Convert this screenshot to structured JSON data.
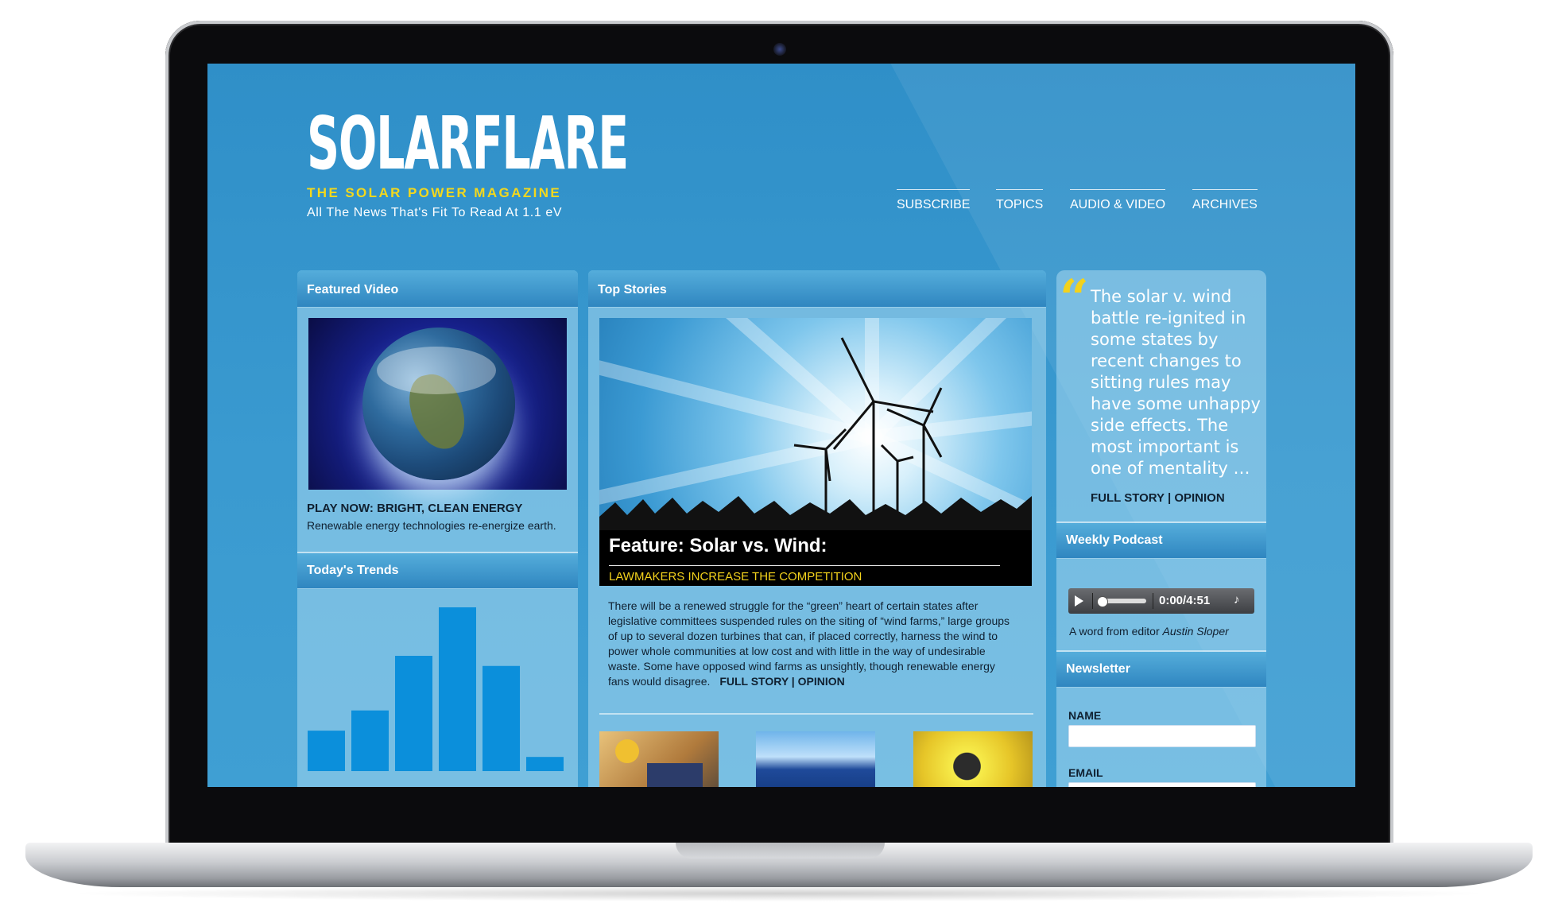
{
  "site": {
    "logo": "SOLARFLARE",
    "tagline": "THE SOLAR POWER MAGAZINE",
    "subtitle": "All The News That's Fit To Read At 1.1 eV"
  },
  "nav": {
    "items": [
      {
        "label": "SUBSCRIBE"
      },
      {
        "label": "TOPICS"
      },
      {
        "label": "AUDIO & VIDEO"
      },
      {
        "label": "ARCHIVES"
      }
    ]
  },
  "featured_video": {
    "heading": "Featured Video",
    "title": "PLAY NOW: BRIGHT, CLEAN ENERGY",
    "description": "Renewable energy technologies re-energize earth."
  },
  "trends": {
    "heading": "Today's Trends",
    "chart_data": {
      "type": "bar",
      "values": [
        20,
        30,
        57,
        81,
        52,
        7
      ],
      "color": "#0b8fdb"
    }
  },
  "top_stories": {
    "heading": "Top Stories",
    "feature_title": "Feature: Solar vs. Wind:",
    "feature_subtitle": "LAWMAKERS INCREASE THE COMPETITION",
    "body": "There will be a renewed struggle for the “green” heart of certain states after legislative committees suspended rules on the siting of “wind farms,” large groups of up to several dozen turbines that can, if placed correctly, harness the wind to power whole communities at low cost and with little in the way of undesirable waste. Some have opposed wind farms as unsightly, though renewable energy fans would disagree.",
    "link": "FULL STORY | OPINION"
  },
  "quote": {
    "mark": "“",
    "text": "The solar v. wind battle re-ignited in some states by recent changes to sitting rules may have some unhappy side effects. The most important is one of mentality …",
    "link": "FULL STORY | OPINION"
  },
  "podcast": {
    "heading": "Weekly Podcast",
    "time": "0:00/4:51",
    "caption_prefix": "A word from editor ",
    "caption_name": "Austin Sloper"
  },
  "newsletter": {
    "heading": "Newsletter",
    "name_label": "NAME",
    "email_label": "EMAIL"
  },
  "colors": {
    "background": "#3a9ad0",
    "accent": "#f3d21c",
    "bar": "#0b8fdb"
  }
}
